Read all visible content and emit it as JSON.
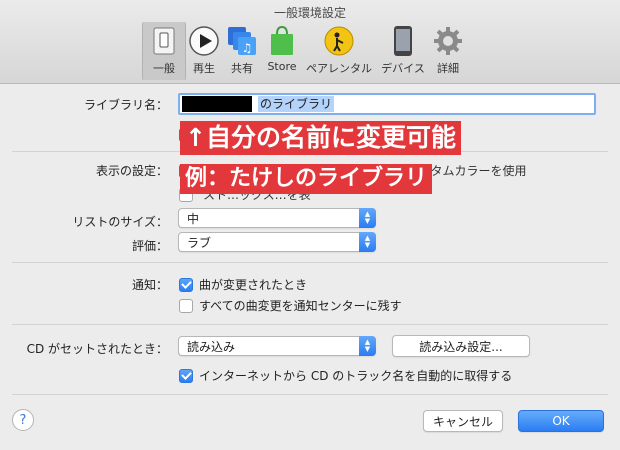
{
  "window": {
    "title": "一般環境設定"
  },
  "toolbar": {
    "items": [
      {
        "label": "一般",
        "icon": "switch-icon",
        "selected": true
      },
      {
        "label": "再生",
        "icon": "play-icon"
      },
      {
        "label": "共有",
        "icon": "shared-library-icon"
      },
      {
        "label": "Store",
        "icon": "store-bag-icon"
      },
      {
        "label": "ペアレンタル",
        "icon": "parental-icon"
      },
      {
        "label": "デバイス",
        "icon": "device-icon"
      },
      {
        "label": "詳細",
        "icon": "gear-icon"
      }
    ]
  },
  "library": {
    "label": "ライブラリ名：",
    "value_suffix": "のライブラリ",
    "partial_checkbox": "ゃ",
    "partial_checkbox_tail": "を"
  },
  "display": {
    "label": "表示の設定：",
    "option1": "聞いて…るアルバム…や…ビ…などのカスタムカラーを使用",
    "option2": "スト…ックス…を表"
  },
  "list_size": {
    "label": "リストのサイズ：",
    "value": "中"
  },
  "rating": {
    "label": "評価：",
    "value": "ラブ"
  },
  "notify": {
    "label": "通知：",
    "option1": "曲が変更されたとき",
    "option2": "すべての曲変更を通知センターに残す"
  },
  "cd": {
    "label": "CD がセットされたとき：",
    "value": "読み込み",
    "settings_button": "読み込み設定...",
    "option": "インターネットから CD のトラック名を自動的に取得する"
  },
  "footer": {
    "help": "?",
    "cancel": "キャンセル",
    "ok": "OK"
  },
  "annotation": {
    "line1": "↑自分の名前に変更可能",
    "line2": "例：たけしのライブラリ"
  },
  "colors": {
    "accent": "#2b7df3",
    "annotation": "#e2383b",
    "selection": "#b3d3fb"
  }
}
